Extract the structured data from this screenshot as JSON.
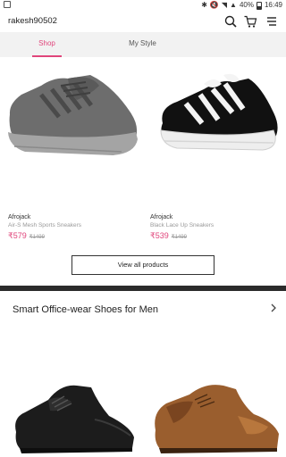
{
  "status_bar": {
    "battery": "40%",
    "time": "16:49"
  },
  "header": {
    "username": "rakesh90502"
  },
  "tabs": [
    {
      "label": "Shop"
    },
    {
      "label": "My Style"
    }
  ],
  "products": [
    {
      "brand": "Afrojack",
      "name": "Air-S Mesh Sports Sneakers",
      "price": "₹579",
      "mrp": "₹1499"
    },
    {
      "brand": "Afrojack",
      "name": "Black Lace Up Sneakers",
      "price": "₹539",
      "mrp": "₹1499"
    }
  ],
  "view_all_label": "View all products",
  "section": {
    "title": "Smart Office-wear Shoes for Men"
  },
  "colors": {
    "accent": "#e0457b",
    "divider": "#2b2b2b",
    "tab_bg": "#f2f2f2"
  }
}
